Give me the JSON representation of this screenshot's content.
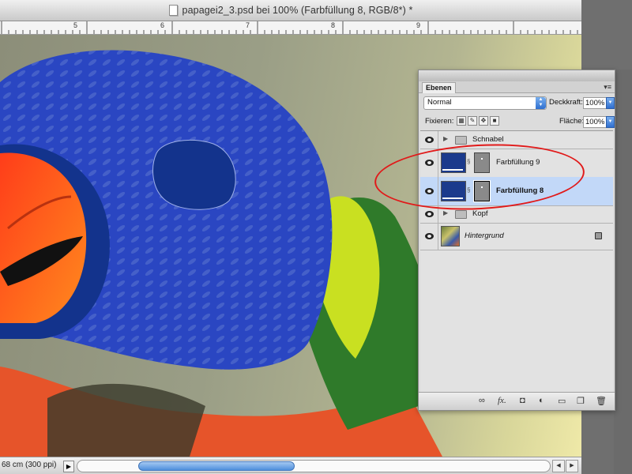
{
  "window": {
    "title": "papagei2_3.psd bei 100% (Farbfüllung 8, RGB/8*) *"
  },
  "ruler": {
    "numbers": [
      "5",
      "6",
      "7",
      "8",
      "9"
    ]
  },
  "status": {
    "doc_size": "68 cm (300 ppi)",
    "menu_arrow": "▶"
  },
  "layers_panel": {
    "tab_label": "Ebenen",
    "menu_glyph": "▾≡",
    "blend_mode": "Normal",
    "opacity_label": "Deckkraft:",
    "opacity_value": "100%",
    "lock_label": "Fixieren:",
    "fill_label": "Fläche:",
    "fill_value": "100%",
    "layers": [
      {
        "name": "Schnabel",
        "type": "group",
        "visible": true,
        "selected": false
      },
      {
        "name": "Farbfüllung 9",
        "type": "fill",
        "visible": true,
        "selected": false
      },
      {
        "name": "Farbfüllung 8",
        "type": "fill",
        "visible": true,
        "selected": true
      },
      {
        "name": "Kopf",
        "type": "group",
        "visible": true,
        "selected": false
      },
      {
        "name": "Hintergrund",
        "type": "background",
        "visible": true,
        "selected": false
      }
    ],
    "bottom_icons": [
      "link-icon",
      "fx-icon",
      "mask-icon",
      "adjustment-icon",
      "folder-icon",
      "new-layer-icon",
      "trash-icon"
    ],
    "bottom_glyphs": {
      "fx": "fx."
    }
  },
  "colors": {
    "selected_row": "#c2d8f8",
    "annotation": "#e11a1a",
    "fill_blue": "#1b3a8c"
  }
}
